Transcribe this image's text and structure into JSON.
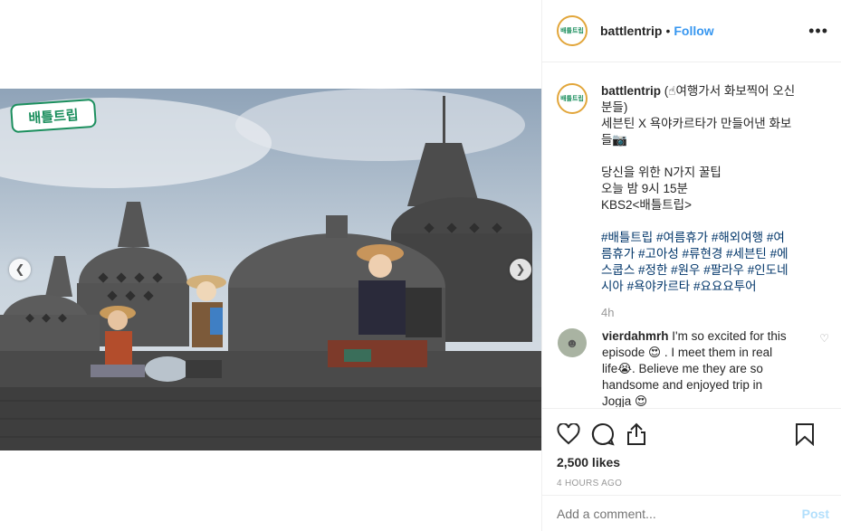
{
  "post": {
    "account": "battlentrip",
    "dot": "•",
    "follow_label": "Follow",
    "more_icon": "more-horizontal-icon",
    "avatar_text": "배틀트립",
    "photo_logo_text": "배틀트립"
  },
  "caption": {
    "user": "battlentrip",
    "lines": [
      "(☝여행가서 화보찍어 오신",
      "분들)",
      "세븐틴 X 욕야카르타가 만들어낸 화보",
      "들📷",
      "",
      "당신을 위한 N가지 꿀팁",
      "오늘 밤 9시 15분",
      "KBS2<배틀트립>",
      ""
    ],
    "tags": [
      "#배틀트립 #여름휴가 #해외여행 #여",
      "름휴가 #고아성 #류현경 #세븐틴 #에",
      "스쿱스 #정한 #원우 #팔라우 #인도네",
      "시아 #욕야카르타 #요요요투어"
    ],
    "time": "4h"
  },
  "comment": {
    "user": "vierdahmrh",
    "lines": [
      "I'm so excited for this",
      "episode 😍 . I meet them in real",
      "life😭. Believe me they are so",
      "handsome and enjoyed trip in",
      "Jogja 😍"
    ]
  },
  "actions": {
    "likes": "2,500 likes",
    "posted": "4 HOURS AGO"
  },
  "add_comment": {
    "placeholder": "Add a comment...",
    "post_label": "Post"
  },
  "colors": {
    "link": "#3897f0",
    "hashtag": "#003569",
    "muted": "#999999",
    "border": "#efefef",
    "logo_green": "#1c8f5e"
  }
}
